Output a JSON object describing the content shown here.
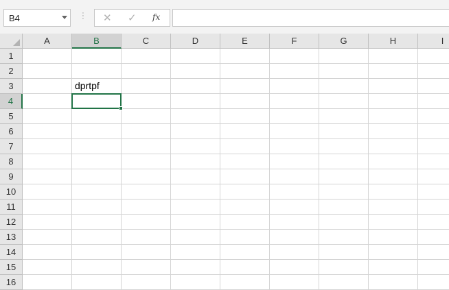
{
  "name_box": {
    "value": "B4"
  },
  "formula_bar": {
    "cancel_icon": "✕",
    "enter_icon": "✓",
    "fx_label": "fx",
    "content": ""
  },
  "columns": [
    "A",
    "B",
    "C",
    "D",
    "E",
    "F",
    "G",
    "H",
    "I"
  ],
  "rows": [
    "1",
    "2",
    "3",
    "4",
    "5",
    "6",
    "7",
    "8",
    "9",
    "10",
    "11",
    "12",
    "13",
    "14",
    "15",
    "16"
  ],
  "active_cell": {
    "column": "B",
    "row": "4"
  },
  "cells": [
    {
      "column": "B",
      "row": "3",
      "text": "dprtpf"
    }
  ],
  "colors": {
    "accent": "#217346",
    "header_bg": "#e6e6e6",
    "gridline": "#d4d4d4"
  }
}
